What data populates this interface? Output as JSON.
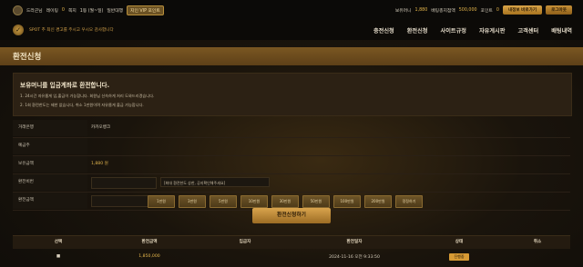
{
  "topbar": {
    "user": "드라곤님",
    "points_label": "레이팅",
    "points_value": "0",
    "unread": "쪽지",
    "level": "1등 (월~일)",
    "bonus": "일반대행",
    "badge": "지인 VIP 포인트",
    "balance_label": "보유머니",
    "balance_value": "1,880",
    "bank_label": "배팅총지점액",
    "bank_value": "500,000",
    "point_label": "포인트",
    "point_value": "0",
    "btn_myinfo": "내정보 바로가기",
    "btn_logout": "로그아웃"
  },
  "nav": {
    "notice": "SPOT 추 최신 경고를 주시고 우시오 감사합니다",
    "menu": [
      "충전신청",
      "환전신청",
      "사이트규정",
      "자유게시판",
      "고객센터",
      "배팅내역"
    ]
  },
  "page": {
    "title": "환전신청"
  },
  "info": {
    "heading": "보유머니를 입금계좌로 환전합니다.",
    "line1": "1. 24시간 자유롭게 입,출금이 가능합니다. 회원님 신속하게 처리 도와드리겠습니다.",
    "line2": "2. 1회 환전한도는 제한 없습니다, 취소 1만원이며 자유롭게 출금 가능합니다."
  },
  "form": {
    "rows": [
      {
        "label": "거래은행",
        "value": "카카오뱅크"
      },
      {
        "label": "예금주",
        "value": ""
      },
      {
        "label": "보유금액",
        "value": "1,880 원"
      },
      {
        "label": "환전비번",
        "value": ""
      },
      {
        "label": "환전금액",
        "value": ""
      }
    ],
    "pw_note": "[최대 환전한도 상한, 공지확인해주세요]",
    "amount_buttons": [
      "1만원",
      "3만원",
      "5만원",
      "10만원",
      "30만원",
      "50만원",
      "100만원",
      "200만원",
      "정정하기"
    ],
    "submit": "환전신청하기"
  },
  "table": {
    "headers": [
      "선택",
      "환전금액",
      "입금자",
      "환전일자",
      "상태",
      "취소"
    ],
    "rows": [
      {
        "select": "■",
        "amount": "1,850,000",
        "depositor": "",
        "date": "2024-11-16 오전 9:33:50",
        "status": "진행중",
        "cancel": ""
      }
    ]
  }
}
